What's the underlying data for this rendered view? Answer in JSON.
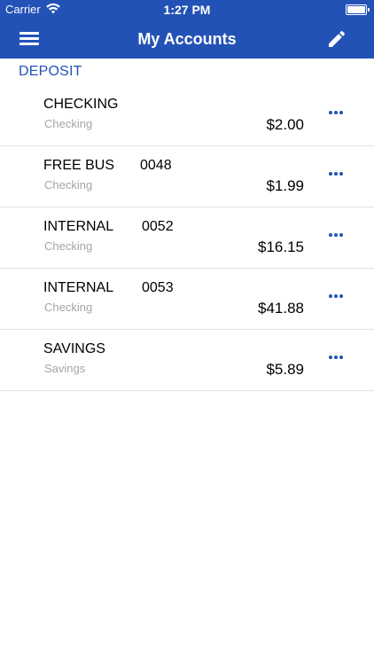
{
  "status_bar": {
    "carrier": "Carrier",
    "time": "1:27 PM"
  },
  "nav": {
    "title": "My Accounts",
    "menu_icon": "hamburger-menu-icon",
    "edit_icon": "pencil-icon"
  },
  "colors": {
    "brand": "#2352b6",
    "subtext": "#a5a5a5",
    "divider": "#e2e2e2"
  },
  "section": {
    "title": "DEPOSIT"
  },
  "accounts": [
    {
      "name": "CHECKING",
      "number": "",
      "type": "Checking",
      "balance": "$2.00"
    },
    {
      "name": "FREE BUS",
      "number": "0048",
      "type": "Checking",
      "balance": "$1.99"
    },
    {
      "name": "INTERNAL",
      "number": "0052",
      "type": "Checking",
      "balance": "$16.15"
    },
    {
      "name": "INTERNAL",
      "number": "0053",
      "type": "Checking",
      "balance": "$41.88"
    },
    {
      "name": "SAVINGS",
      "number": "",
      "type": "Savings",
      "balance": "$5.89"
    }
  ]
}
